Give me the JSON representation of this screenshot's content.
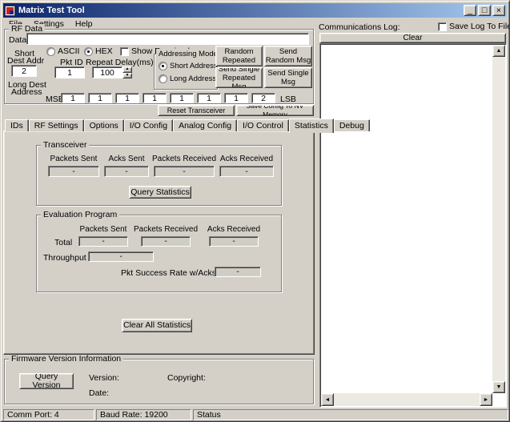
{
  "window": {
    "title": "Matrix Test Tool"
  },
  "icons": {
    "minimize": "_",
    "maximize": "□",
    "close": "×",
    "up": "▲",
    "down": "▼",
    "left": "◄",
    "right": "►",
    "spin_up": "▲",
    "spin_down": "▼"
  },
  "menu": {
    "items": [
      "File",
      "Settings",
      "Help"
    ]
  },
  "rf": {
    "group": "RF Data",
    "data_label": "Data",
    "data_value": "",
    "ascii": "ASCII",
    "hex": "HEX",
    "show_received": "Show Received",
    "short_l1": "Short",
    "short_l2": "Dest Addr",
    "short_value": "2",
    "long_l1": "Long Dest",
    "long_l2": "Address",
    "pkt_id_label": "Pkt ID",
    "pkt_id_value": "1",
    "delay_label": "Repeat Delay(ms)",
    "delay_value": "100",
    "addr_mode": {
      "group": "Addressing Mode",
      "short": "Short Address",
      "long": "Long Address"
    },
    "btn_rand_rep": "Send Random Repeated Msg",
    "btn_rand": "Send Random Msg",
    "btn_single_rep": "Send Single Repeated Msg",
    "btn_single": "Send Single Msg",
    "msb": "MSB",
    "lsb": "LSB",
    "long_addr": [
      "1",
      "1",
      "1",
      "1",
      "1",
      "1",
      "1",
      "2"
    ]
  },
  "actions": {
    "reset": "Reset Transceiver",
    "save_nv": "Save Config To NV Memory"
  },
  "tabs": [
    "IDs",
    "RF Settings",
    "Options",
    "I/O Config",
    "Analog Config",
    "I/O Control",
    "Statistics",
    "Debug"
  ],
  "stats": {
    "transceiver": {
      "group": "Transceiver",
      "cols": [
        "Packets Sent",
        "Acks Sent",
        "Packets Received",
        "Acks Received"
      ],
      "vals": [
        "-",
        "-",
        "-",
        "-"
      ],
      "query": "Query Statistics"
    },
    "eval": {
      "group": "Evaluation Program",
      "cols": [
        "Packets Sent",
        "Packets Received",
        "Acks Received"
      ],
      "total_label": "Total",
      "total_vals": [
        "-",
        "-",
        "-"
      ],
      "throughput_label": "Throughput",
      "throughput_val": "-",
      "success_label": "Pkt Success Rate w/Acks",
      "success_val": "-"
    },
    "clear_all": "Clear All Statistics"
  },
  "firmware": {
    "group": "Firmware Version Information",
    "query": "Query Version",
    "version_label": "Version:",
    "date_label": "Date:",
    "copyright_label": "Copyright:"
  },
  "log": {
    "label": "Communications Log:",
    "save_to_file": "Save Log To File",
    "clear": "Clear"
  },
  "status": {
    "comm_port": "Comm Port: 4",
    "baud": "Baud Rate: 19200",
    "state": "Status"
  }
}
